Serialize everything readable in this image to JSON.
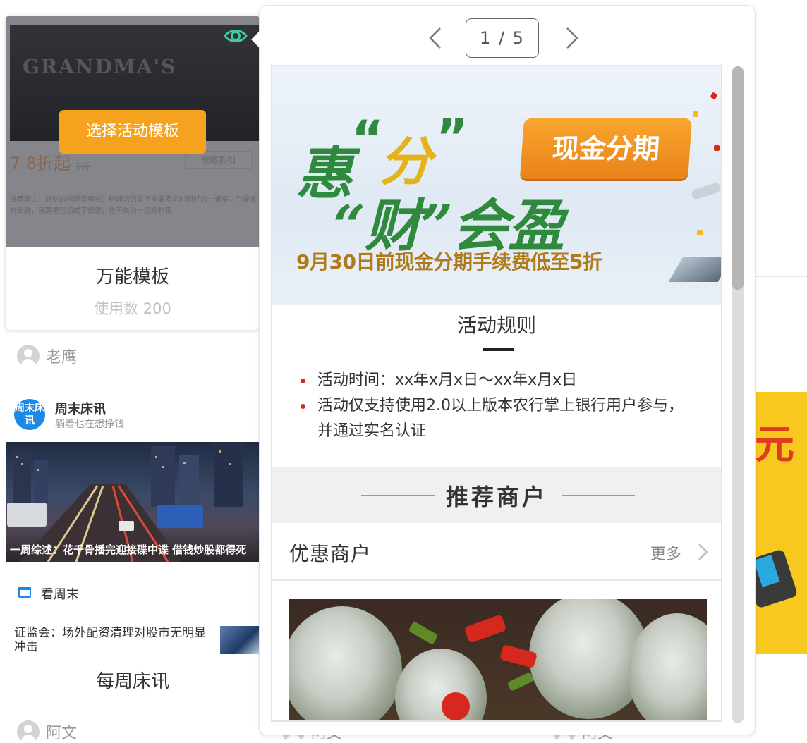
{
  "template_card": {
    "preview": {
      "logo_text": "GRANDMA'S",
      "price": "7.8折起",
      "price_orig": "9折",
      "ghost_button": "领取折扣",
      "desc": "推荐理由：好吃的料理有哪些？料理您的是不需要考虑时间好的一道菜，只要食材新鲜，就算把它切成了便便，也不失为一道好料理！"
    },
    "pick_button": "选择活动模板",
    "name": "万能模板",
    "usage": "使用数 200",
    "author": "老鹰"
  },
  "news_card": {
    "logo_text": "周末床讯",
    "title": "周末床讯",
    "subtitle": "躺着也在想挣钱",
    "photo_caption": "一周综述：花千骨播完迎接碟中谍 借钱炒股都得死",
    "weekend_label": "看周末",
    "headline": "证监会：场外配资清理对股市无明显冲击",
    "name": "每周床讯",
    "author": "阿文"
  },
  "background": {
    "banner_char": "元",
    "bottom_authors": [
      "阿文",
      "阿文"
    ]
  },
  "preview_popup": {
    "pager": "1 / 5",
    "hero": {
      "hui": "惠",
      "fen": "分",
      "line2": "“财”会盈",
      "tag": "现金分期",
      "sub": "9月30日前现金分期手续费低至5折"
    },
    "rules_title": "活动规则",
    "rules": [
      "活动时间：xx年x月x日～xx年x月x日",
      "活动仅支持使用2.0以上版本农行掌上银行用户参与，并通过实名认证"
    ],
    "section_title": "推荐商户",
    "merchant_title": "优惠商户",
    "more": "更多",
    "scroll_fraction": 0.34
  },
  "colors": {
    "accent_orange": "#f5a21e",
    "brand_blue": "#1e88e5",
    "hero_green": "#2f8a3e",
    "rule_bullet": "#d6281e"
  },
  "icons": {
    "preview": "eye-icon",
    "prev": "chevron-left-icon",
    "next": "chevron-right-icon",
    "more": "chevron-right-icon",
    "calendar": "calendar-icon",
    "avatar": "user-avatar-icon"
  }
}
